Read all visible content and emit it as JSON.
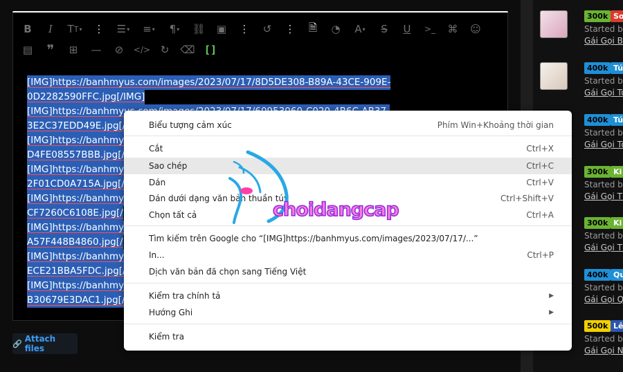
{
  "editor": {
    "toolbar_row1": [
      "bold-icon",
      "italic-icon",
      "text-size-icon",
      "more-icon",
      "list-icon",
      "align-icon",
      "paragraph-icon",
      "link-icon",
      "image-icon",
      "more-icon",
      "undo-icon",
      "more-icon",
      "preview-icon",
      "palette-icon",
      "font-icon",
      "strikethrough-icon",
      "underline-icon",
      "code-icon",
      "gamepad-icon",
      "smile-icon"
    ],
    "toolbar_row2": [
      "media-icon",
      "quote-icon",
      "table-icon",
      "hr-icon",
      "hide-icon",
      "code-tag-icon",
      "redo-icon",
      "eraser-icon",
      "brackets-icon"
    ],
    "content_lines": [
      "[IMG]https://banhmyus.com/images/2023/07/17/8D5DE308-B89A-43CE-909E-",
      "0D2282590FFC.jpg[/IMG]",
      "[IMG]https://banhmyus.com/images/2023/07/17/60953060-C020-4B6C-AB37-",
      "3E2C37EDD49E.jpg[/",
      "[IMG]https://banhmyu",
      "D4FE08557BBB.jpg[/",
      "[IMG]https://banhmyu",
      "2F01CD0A715A.jpg[/",
      "[IMG]https://banhmyu",
      "CF7260C6108E.jpg[/",
      "[IMG]https://banhmyu",
      "A57F448B4860.jpg[/",
      "[IMG]https://banhmyu",
      "ECE21BBA5FDC.jpg[/",
      "[IMG]https://banhmyu",
      "B30679E3DAC1.jpg[/"
    ],
    "attach_label": "Attach files"
  },
  "context_menu": {
    "items": [
      {
        "label": "Biểu tượng cảm xúc",
        "shortcut": "Phím Win+Khoảng thời gian"
      },
      {
        "label": "Cắt",
        "shortcut": "Ctrl+X"
      },
      {
        "label": "Sao chép",
        "shortcut": "Ctrl+C",
        "active": true
      },
      {
        "label": "Dán",
        "shortcut": "Ctrl+V"
      },
      {
        "label": "Dán dưới dạng văn bản thuần túy",
        "shortcut": "Ctrl+Shift+V"
      },
      {
        "label": "Chọn tất cả",
        "shortcut": "Ctrl+A"
      },
      {
        "label": "Tìm kiếm trên Google cho “[IMG]https://banhmyus.com/images/2023/07/17/...”",
        "shortcut": ""
      },
      {
        "label": "In...",
        "shortcut": "Ctrl+P"
      },
      {
        "label": "Dịch văn bản đã chọn sang Tiếng Việt",
        "shortcut": ""
      },
      {
        "label": "Kiểm tra chính tả",
        "shortcut": "",
        "submenu": true
      },
      {
        "label": "Hướng Ghi",
        "shortcut": "",
        "submenu": true
      },
      {
        "label": "Kiểm tra",
        "shortcut": ""
      }
    ]
  },
  "watermark": {
    "text": "choidangcap"
  },
  "sidebar": {
    "threads": [
      {
        "badge": "300k",
        "badge_color": "#6bb333",
        "tag": "So",
        "tag_color": "#d93b2b",
        "started": "Started by",
        "title": "Gái Gọi Bá"
      },
      {
        "badge": "400k",
        "badge_color": "#1f8fd6",
        "tag": "Tú",
        "tag_color": "#1f8fd6",
        "started": "Started by",
        "title": "Gái Gọi Tú"
      },
      {
        "badge": "400k",
        "badge_color": "#1f8fd6",
        "tag": "Tú",
        "tag_color": "#1f8fd6",
        "started": "Started by",
        "title": "Gái Gọi Tô"
      },
      {
        "badge": "300k",
        "badge_color": "#6bb333",
        "tag": "Ki",
        "tag_color": "#6bb333",
        "started": "Started by",
        "title": "Gái Gọi Th"
      },
      {
        "badge": "300k",
        "badge_color": "#6bb333",
        "tag": "Ki",
        "tag_color": "#6bb333",
        "started": "Started by",
        "title": "Gái Gọi Th"
      },
      {
        "badge": "400k",
        "badge_color": "#1f8fd6",
        "tag": "Qu",
        "tag_color": "#1f8fd6",
        "started": "Started by",
        "title": "Gái Gọi Qu"
      },
      {
        "badge": "500k",
        "badge_color": "#f1d000",
        "tag": "Lê",
        "tag_color": "#2c55b0",
        "started": "Started by",
        "title": "Gái Gọi Ng"
      }
    ]
  }
}
